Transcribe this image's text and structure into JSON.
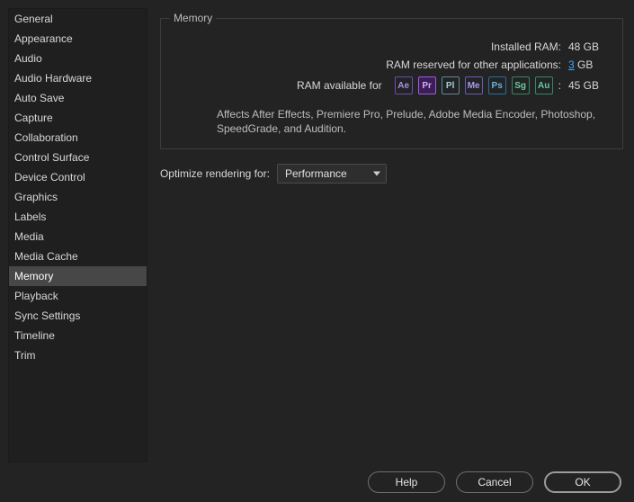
{
  "sidebar": {
    "items": [
      {
        "label": "General"
      },
      {
        "label": "Appearance"
      },
      {
        "label": "Audio"
      },
      {
        "label": "Audio Hardware"
      },
      {
        "label": "Auto Save"
      },
      {
        "label": "Capture"
      },
      {
        "label": "Collaboration"
      },
      {
        "label": "Control Surface"
      },
      {
        "label": "Device Control"
      },
      {
        "label": "Graphics"
      },
      {
        "label": "Labels"
      },
      {
        "label": "Media"
      },
      {
        "label": "Media Cache"
      },
      {
        "label": "Memory"
      },
      {
        "label": "Playback"
      },
      {
        "label": "Sync Settings"
      },
      {
        "label": "Timeline"
      },
      {
        "label": "Trim"
      }
    ],
    "active_index": 13
  },
  "memory": {
    "group_title": "Memory",
    "installed_label": "Installed RAM:",
    "installed_value": "48 GB",
    "reserved_label": "RAM reserved for other applications:",
    "reserved_value": "3",
    "reserved_unit": " GB",
    "available_label": "RAM available for",
    "available_colon": ":",
    "available_value": "45 GB",
    "apps": [
      {
        "abbr": "Ae",
        "cls": "ico-ae",
        "name": "after-effects-icon"
      },
      {
        "abbr": "Pr",
        "cls": "ico-pr",
        "name": "premiere-pro-icon"
      },
      {
        "abbr": "Pl",
        "cls": "ico-pl",
        "name": "prelude-icon"
      },
      {
        "abbr": "Me",
        "cls": "ico-me",
        "name": "media-encoder-icon"
      },
      {
        "abbr": "Ps",
        "cls": "ico-ps",
        "name": "photoshop-icon"
      },
      {
        "abbr": "Sg",
        "cls": "ico-sg",
        "name": "speedgrade-icon"
      },
      {
        "abbr": "Au",
        "cls": "ico-au",
        "name": "audition-icon"
      }
    ],
    "affects_text": "Affects After Effects, Premiere Pro, Prelude, Adobe Media Encoder, Photoshop, SpeedGrade, and Audition."
  },
  "optimize": {
    "label": "Optimize rendering for:",
    "selected": "Performance"
  },
  "footer": {
    "help": "Help",
    "cancel": "Cancel",
    "ok": "OK"
  }
}
